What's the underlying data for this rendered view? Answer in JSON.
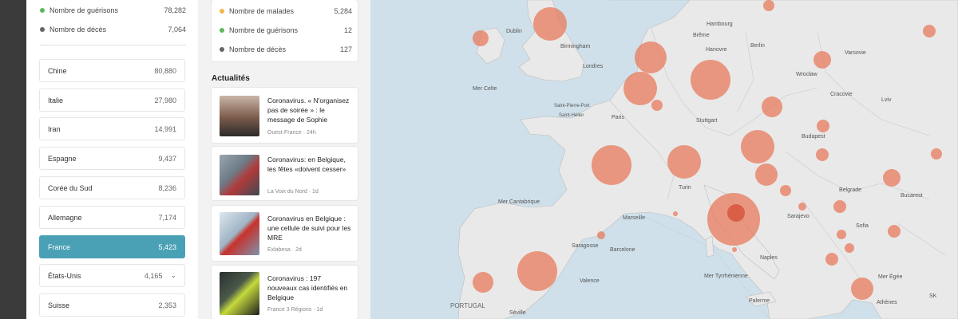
{
  "summary": {
    "recovered_label": "Nombre de guérisons",
    "recovered_value": "78,282",
    "deaths_label": "Nombre de décès",
    "deaths_value": "7,064",
    "colors": {
      "recovered": "#5db85c",
      "deaths": "#666666",
      "sick": "#f0b64b",
      "selected": "#4aa1b5",
      "bubble": "#e8765a"
    }
  },
  "countries": [
    {
      "name": "Chine",
      "value": "80,880"
    },
    {
      "name": "Italie",
      "value": "27,980"
    },
    {
      "name": "Iran",
      "value": "14,991"
    },
    {
      "name": "Espagne",
      "value": "9,437"
    },
    {
      "name": "Corée du Sud",
      "value": "8,236"
    },
    {
      "name": "Allemagne",
      "value": "7,174"
    },
    {
      "name": "France",
      "value": "5,423",
      "selected": true
    },
    {
      "name": "États-Unis",
      "value": "4,165",
      "expandable": true
    },
    {
      "name": "Suisse",
      "value": "2,353"
    }
  ],
  "detail": {
    "sick_label": "Nombre de malades",
    "sick_value": "5,284",
    "recovered_label": "Nombre de guérisons",
    "recovered_value": "12",
    "deaths_label": "Nombre de décès",
    "deaths_value": "127"
  },
  "news_section_title": "Actualités",
  "news": [
    {
      "title": "Coronavirus. « N'organisez pas de soirée » : le message de Sophie",
      "source": "Ouest-France",
      "age": "24h"
    },
    {
      "title": "Coronavirus: en Belgique, les fêtes «doivent cesser»",
      "source": "La Voix du Nord",
      "age": "1d"
    },
    {
      "title": "Coronavirus en Belgique : une cellule de suivi pour les MRE",
      "source": "Exlabesa",
      "age": "2d"
    },
    {
      "title": "Coronavirus : 197 nouveaux cas identifiés en Belgique",
      "source": "France 3 Régions",
      "age": "1d"
    }
  ],
  "map": {
    "labels": {
      "dublin": "Dublin",
      "birmingham": "Birmingham",
      "londres": "Londres",
      "mer_celte": "Mer Celte",
      "paris": "Paris",
      "saint_pierre": "Saint-Pierre-Port",
      "saint_helier": "Saint-Hélier",
      "mer_cantabrique": "Mer Cantabrique",
      "turin": "Turin",
      "marseille": "Marseille",
      "saragosse": "Saragosse",
      "barcelone": "Barcelone",
      "valence": "Valence",
      "portugal": "PORTUGAL",
      "seville": "Séville",
      "hambourg": "Hambourg",
      "breme": "Brême",
      "berlin": "Berlin",
      "hanovre": "Hanovre",
      "varsovie": "Varsovie",
      "wroclaw": "Wrocław",
      "cracovie": "Cracovie",
      "lviv": "Lviv",
      "stuttgart": "Stuttgart",
      "budapest": "Budapest",
      "belgrade": "Belgrade",
      "bucarest": "Bucarest",
      "sarajevo": "Sarajevo",
      "sofia": "Sofia",
      "naples": "Naples",
      "mer_tyrrhenienne": "Mer Tyrrhénienne",
      "palerme": "Palerme",
      "mer_egee": "Mer Égée",
      "athenes": "Athènes",
      "sk": "SK"
    }
  }
}
